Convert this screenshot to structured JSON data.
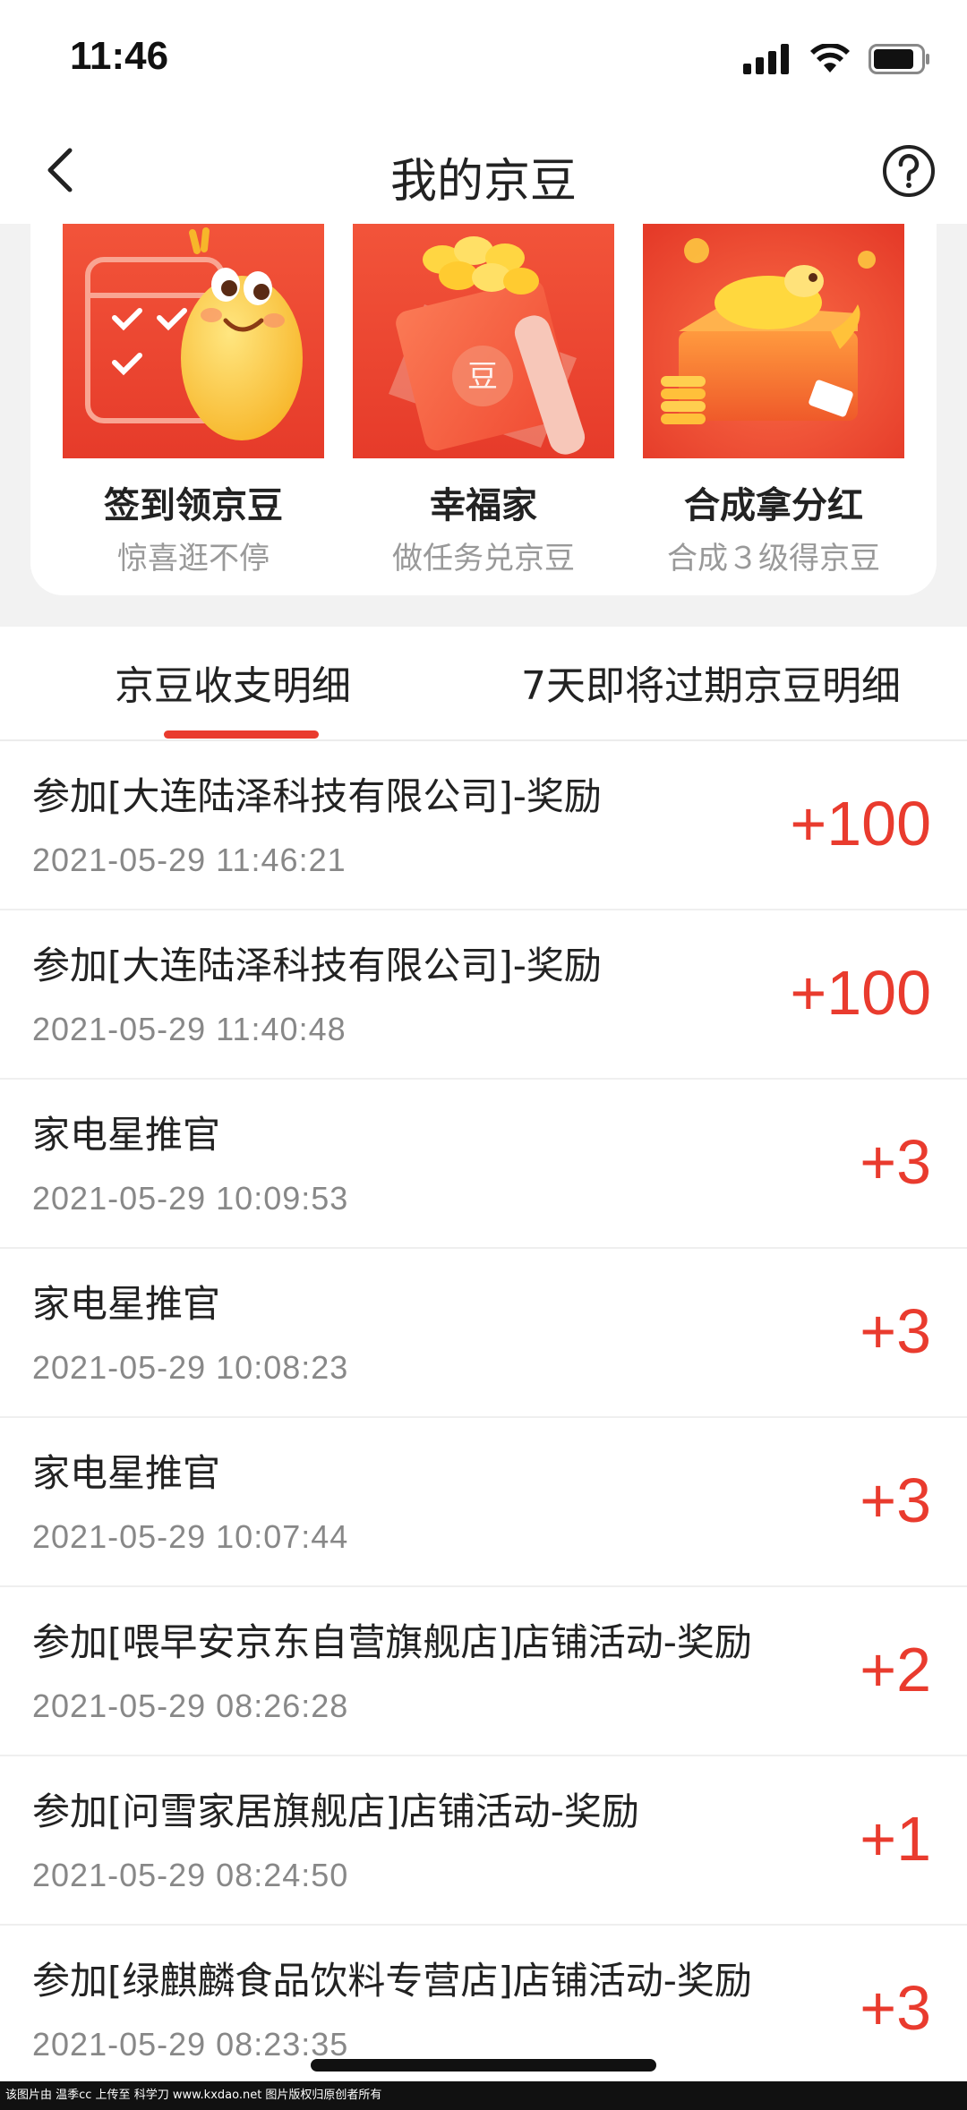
{
  "status_bar": {
    "time": "11:46"
  },
  "nav": {
    "title": "我的京豆"
  },
  "cards": [
    {
      "title": "签到领京豆",
      "subtitle": "惊喜逛不停"
    },
    {
      "title": "幸福家",
      "subtitle": "做任务兑京豆",
      "badge": "豆"
    },
    {
      "title": "合成拿分红",
      "subtitle": "合成３级得京豆"
    }
  ],
  "tabs": [
    {
      "label": "京豆收支明细",
      "active": true
    },
    {
      "label": "7天即将过期京豆明细",
      "active": false
    }
  ],
  "records": [
    {
      "title": "参加[大连陆泽科技有限公司]-奖励",
      "time": "2021-05-29 11:46:21",
      "amount": "+100"
    },
    {
      "title": "参加[大连陆泽科技有限公司]-奖励",
      "time": "2021-05-29 11:40:48",
      "amount": "+100"
    },
    {
      "title": "家电星推官",
      "time": "2021-05-29 10:09:53",
      "amount": "+3"
    },
    {
      "title": "家电星推官",
      "time": "2021-05-29 10:08:23",
      "amount": "+3"
    },
    {
      "title": "家电星推官",
      "time": "2021-05-29 10:07:44",
      "amount": "+3"
    },
    {
      "title": "参加[喂早安京东自营旗舰店]店铺活动-奖励",
      "time": "2021-05-29 08:26:28",
      "amount": "+2"
    },
    {
      "title": "参加[问雪家居旗舰店]店铺活动-奖励",
      "time": "2021-05-29 08:24:50",
      "amount": "+1"
    },
    {
      "title": "参加[绿麒麟食品饮料专营店]店铺活动-奖励",
      "time": "2021-05-29 08:23:35",
      "amount": "+3"
    }
  ],
  "footer": {
    "text": "该图片由 温季cc 上传至 科学刀 www.kxdao.net 图片版权归原创者所有"
  },
  "colors": {
    "accent": "#e93b2e",
    "text": "#222222",
    "muted": "#888888"
  }
}
